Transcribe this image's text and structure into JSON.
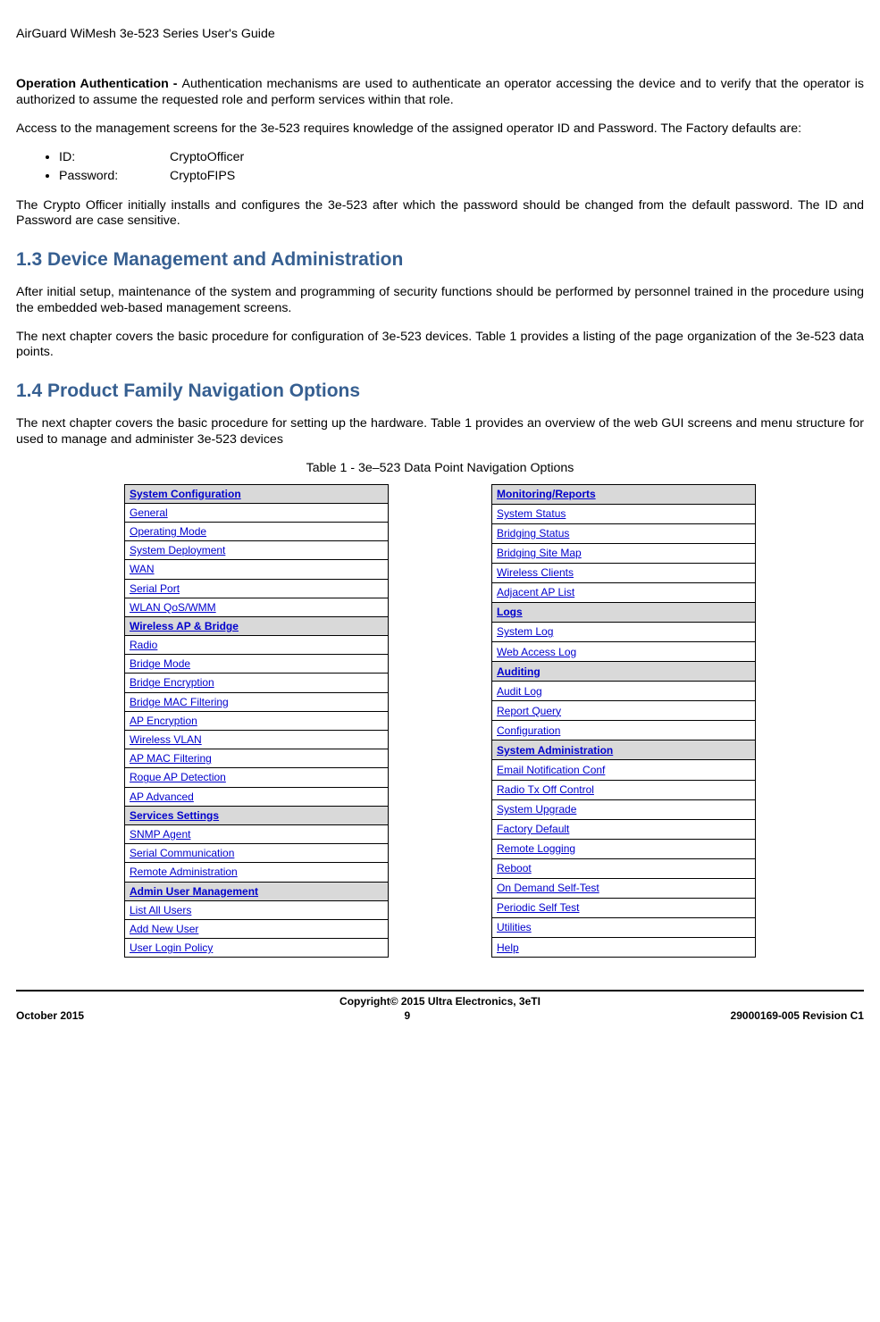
{
  "header": {
    "doc_title": "AirGuard WiMesh 3e-523 Series User's Guide"
  },
  "body": {
    "op_auth_label": "Operation Authentication - ",
    "op_auth_text": "Authentication mechanisms are used to authenticate an operator accessing the device and to verify that the operator is authorized to assume the requested role and perform services within that role.",
    "access_text": "Access to the management screens for the 3e-523 requires knowledge of the assigned operator ID and Password. The Factory defaults are:",
    "cred_id_label": "ID:",
    "cred_id_value": "CryptoOfficer",
    "cred_pw_label": "Password:",
    "cred_pw_value": "CryptoFIPS",
    "crypto_officer_text": "The Crypto Officer initially installs and configures the 3e-523 after which the password should be changed from the default password. The ID and Password are case sensitive.",
    "h13": "1.3  Device Management and Administration",
    "p13a": "After initial setup, maintenance of the system and programming of security functions should be performed by personnel trained in the procedure using the embedded web-based management screens.",
    "p13b": "The next chapter covers the basic procedure for configuration of 3e-523 devices. Table 1 provides a listing of the page organization of the 3e-523 data points.",
    "h14": "1.4  Product Family Navigation Options",
    "p14": "The next chapter covers the basic procedure for setting up the hardware. Table 1 provides an overview of the web GUI screens and menu structure for used to manage and administer 3e-523 devices",
    "table_caption": "Table 1 - 3e–523 Data Point Navigation Options"
  },
  "nav_left": [
    {
      "t": "System Configuration",
      "h": true
    },
    {
      "t": "General"
    },
    {
      "t": "Operating Mode"
    },
    {
      "t": "System Deployment"
    },
    {
      "t": "WAN"
    },
    {
      "t": "Serial Port"
    },
    {
      "t": "WLAN QoS/WMM"
    },
    {
      "t": "Wireless AP & Bridge",
      "h": true
    },
    {
      "t": "Radio"
    },
    {
      "t": "Bridge Mode"
    },
    {
      "t": "Bridge Encryption"
    },
    {
      "t": "Bridge MAC Filtering"
    },
    {
      "t": "AP Encryption"
    },
    {
      "t": "Wireless VLAN"
    },
    {
      "t": "AP MAC Filtering"
    },
    {
      "t": "Rogue AP Detection"
    },
    {
      "t": "AP Advanced"
    },
    {
      "t": "Services Settings",
      "h": true
    },
    {
      "t": "SNMP Agent"
    },
    {
      "t": "Serial Communication"
    },
    {
      "t": "Remote Administration"
    },
    {
      "t": "Admin User Management",
      "h": true
    },
    {
      "t": "List All Users"
    },
    {
      "t": "Add New User"
    },
    {
      "t": "User Login Policy"
    }
  ],
  "nav_right": [
    {
      "t": "Monitoring/Reports",
      "h": true
    },
    {
      "t": "System Status"
    },
    {
      "t": "Bridging Status"
    },
    {
      "t": "Bridging Site Map"
    },
    {
      "t": "Wireless Clients"
    },
    {
      "t": "Adjacent AP List"
    },
    {
      "t": "Logs",
      "h": true
    },
    {
      "t": "System Log"
    },
    {
      "t": "Web Access Log"
    },
    {
      "t": "Auditing",
      "h": true
    },
    {
      "t": "Audit Log"
    },
    {
      "t": "Report Query"
    },
    {
      "t": "Configuration"
    },
    {
      "t": "System Administration",
      "h": true
    },
    {
      "t": "Email Notification Conf"
    },
    {
      "t": "Radio Tx Off Control"
    },
    {
      "t": "System Upgrade"
    },
    {
      "t": "Factory Default"
    },
    {
      "t": "Remote Logging"
    },
    {
      "t": "Reboot"
    },
    {
      "t": "On Demand Self-Test"
    },
    {
      "t": "Periodic Self Test"
    },
    {
      "t": "Utilities"
    },
    {
      "t": "Help"
    }
  ],
  "footer": {
    "copyright": "Copyright© 2015 Ultra Electronics, 3eTI",
    "date": "October 2015",
    "page": "9",
    "docnum": "29000169-005 Revision C1"
  }
}
